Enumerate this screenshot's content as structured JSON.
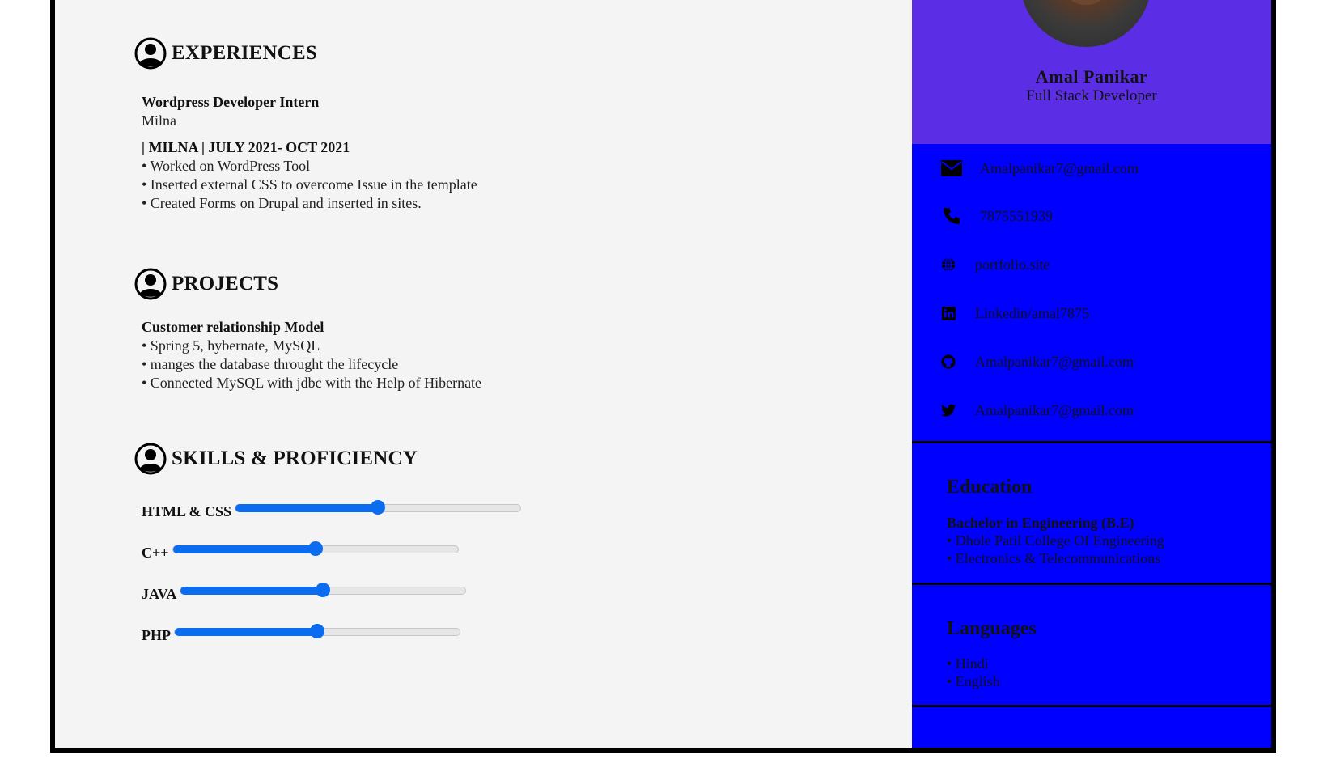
{
  "experiences": {
    "heading": "EXPERIENCES",
    "title": "Wordpress Developer Intern",
    "company": "Milna",
    "period": "| MILNA | JULY 2021- OCT 2021",
    "bullets": [
      "• Worked on WordPress Tool",
      "• Inserted external CSS to overcome Issue in the template",
      "• Created Forms on Drupal and inserted in sites."
    ]
  },
  "projects": {
    "heading": "PROJECTS",
    "title": "Customer relationship Model",
    "bullets": [
      "• Spring 5, hybernate, MySQL",
      "• manges the database throught the lifecycle",
      "• Connected MySQL with jdbc with the Help of Hibernate"
    ]
  },
  "skills": {
    "heading": "SKILLS & PROFICIENCY",
    "items": [
      {
        "label": "HTML & CSS",
        "level": 0.5
      },
      {
        "label": "C++",
        "level": 0.5
      },
      {
        "label": "JAVA",
        "level": 0.5
      },
      {
        "label": "PHP",
        "level": 0.5
      }
    ]
  },
  "profile": {
    "name": "Amal Panikar",
    "role": "Full Stack Developer"
  },
  "contacts": [
    {
      "icon": "envelope-icon",
      "text": "Amalpanikar7@gmail.com"
    },
    {
      "icon": "phone-icon",
      "text": "7875551939"
    },
    {
      "icon": "globe-icon",
      "text": "portfolio.site"
    },
    {
      "icon": "linkedin-icon",
      "text": "Linkedin/amal7875"
    },
    {
      "icon": "github-icon",
      "text": "Amalpanikar7@gmail.com"
    },
    {
      "icon": "twitter-icon",
      "text": "Amalpanikar7@gmail.com"
    }
  ],
  "education": {
    "heading": "Education",
    "degree": "Bachelor in Engineering (B.E)",
    "bullets": [
      "• Dhole Patil College Of Engineering",
      "• Electronics & Telecommunications"
    ]
  },
  "languages": {
    "heading": "Languages",
    "items": [
      "• Hindi",
      "• English"
    ]
  },
  "colors": {
    "sidebar": "#0000ff",
    "profile_bg": "#5b2ee6",
    "slider_accent": "#0b6cf0",
    "page_bg": "#f4f4f4"
  }
}
